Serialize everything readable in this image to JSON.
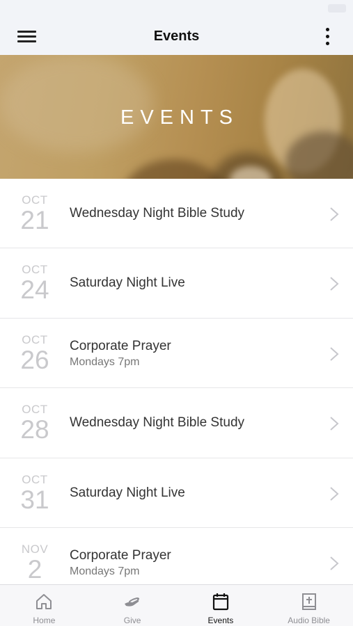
{
  "nav": {
    "title": "Events"
  },
  "hero": {
    "title": "EVENTS"
  },
  "events": [
    {
      "month": "OCT",
      "day": "21",
      "name": "Wednesday Night Bible Study",
      "subtitle": ""
    },
    {
      "month": "OCT",
      "day": "24",
      "name": "Saturday Night Live",
      "subtitle": ""
    },
    {
      "month": "OCT",
      "day": "26",
      "name": "Corporate Prayer",
      "subtitle": "Mondays 7pm"
    },
    {
      "month": "OCT",
      "day": "28",
      "name": "Wednesday Night Bible Study",
      "subtitle": ""
    },
    {
      "month": "OCT",
      "day": "31",
      "name": "Saturday Night Live",
      "subtitle": ""
    },
    {
      "month": "NOV",
      "day": "2",
      "name": "Corporate Prayer",
      "subtitle": "Mondays 7pm"
    }
  ],
  "tabs": [
    {
      "label": "Home",
      "icon": "home-icon",
      "active": false
    },
    {
      "label": "Give",
      "icon": "give-icon",
      "active": false
    },
    {
      "label": "Events",
      "icon": "calendar-icon",
      "active": true
    },
    {
      "label": "Audio Bible",
      "icon": "bible-icon",
      "active": false
    }
  ],
  "colors": {
    "accent": "#111111",
    "inactive_tab": "#8e8e93",
    "date_text": "#c9c9cc",
    "hero_tint": "#bf9f63"
  }
}
